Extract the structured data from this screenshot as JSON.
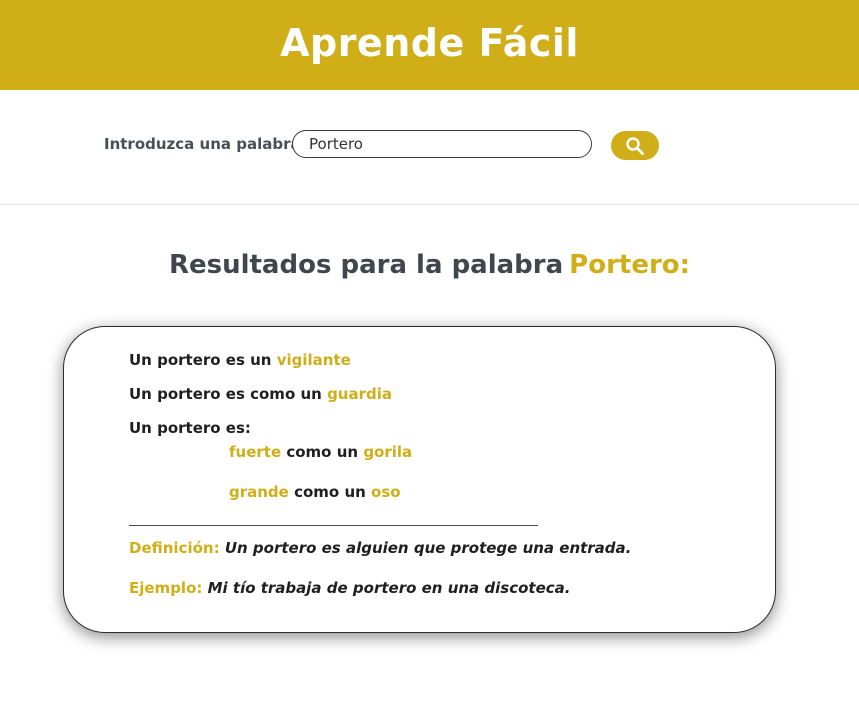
{
  "header": {
    "title": "Aprende Fácil"
  },
  "search": {
    "label": "Introduzca una palabra:",
    "value": "Portero",
    "button_icon": "search-icon"
  },
  "results": {
    "title_prefix": "Resultados para la palabra",
    "word": "Portero:"
  },
  "card": {
    "line1": {
      "prefix": "Un portero es un",
      "highlight": "vigilante"
    },
    "line2": {
      "prefix": "Un portero es como un",
      "highlight": "guardia"
    },
    "line3": {
      "text": "Un portero es:"
    },
    "comparisons": [
      {
        "adjective": "fuerte",
        "middle": "como un",
        "noun": "gorila"
      },
      {
        "adjective": "grande",
        "middle": "como un",
        "noun": "oso"
      }
    ],
    "definition": {
      "label": "Definición:",
      "text": "Un portero es alguien que protege una entrada."
    },
    "example": {
      "label": "Ejemplo:",
      "text": "Mi tío trabaja de portero en una discoteca."
    }
  },
  "colors": {
    "accent": "#cfae17",
    "title_text": "#3f464d"
  }
}
